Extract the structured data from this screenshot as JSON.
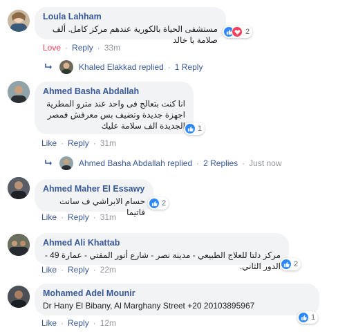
{
  "comments": [
    {
      "author": "Loula Lahham",
      "text": "مستشفى الحياة بالكورية عندهم مركز كامل. ألف صلامة يا خالد",
      "reaction_count": "2",
      "action_like": "Love",
      "action_reply": "Reply",
      "time": "33m",
      "replies": {
        "name": "Khaled Elakkad replied",
        "count": "1 Reply"
      }
    },
    {
      "author": "Ahmed Basha Abdallah",
      "text": "انا كنت بتعالج فى واحد عند مترو المطرية اجهزة جديدة وتضيف بس معرفش فمصر الجديدة الف سلامة عليك",
      "reaction_count": "1",
      "action_like": "Like",
      "action_reply": "Reply",
      "time": "31m",
      "replies": {
        "name": "Ahmed Basha Abdallah replied",
        "count": "2 Replies",
        "time": "Just now"
      }
    },
    {
      "author": "Ahmed Maher El Essawy",
      "text": "حسام الابراشي ف سانت فاتيما",
      "reaction_count": "2",
      "action_like": "Like",
      "action_reply": "Reply",
      "time": "31m"
    },
    {
      "author": "Ahmed Ali Khattab",
      "text": "مركز دلتا للعلاج الطبيعي - مدينة نصر - شارع أنور المفتي - عمارة 49 - الدور الثاني.",
      "reaction_count": "2",
      "action_like": "Like",
      "action_reply": "Reply",
      "time": "22m"
    },
    {
      "author": "Mohamed Adel Mounir",
      "text": "Dr Hany El Bibany, Al Marghany Street +20 20103895967",
      "reaction_count": "1",
      "action_like": "Like",
      "action_reply": "Reply",
      "time": "12m"
    }
  ],
  "icons": {
    "like": "thumbs-up-icon",
    "love": "heart-icon",
    "reply_arrow": "reply-arrow-icon"
  },
  "colors": {
    "link": "#385898",
    "like_blue": "#2d88ff",
    "love_red": "#f33e58",
    "bubble": "#f2f3f5"
  }
}
